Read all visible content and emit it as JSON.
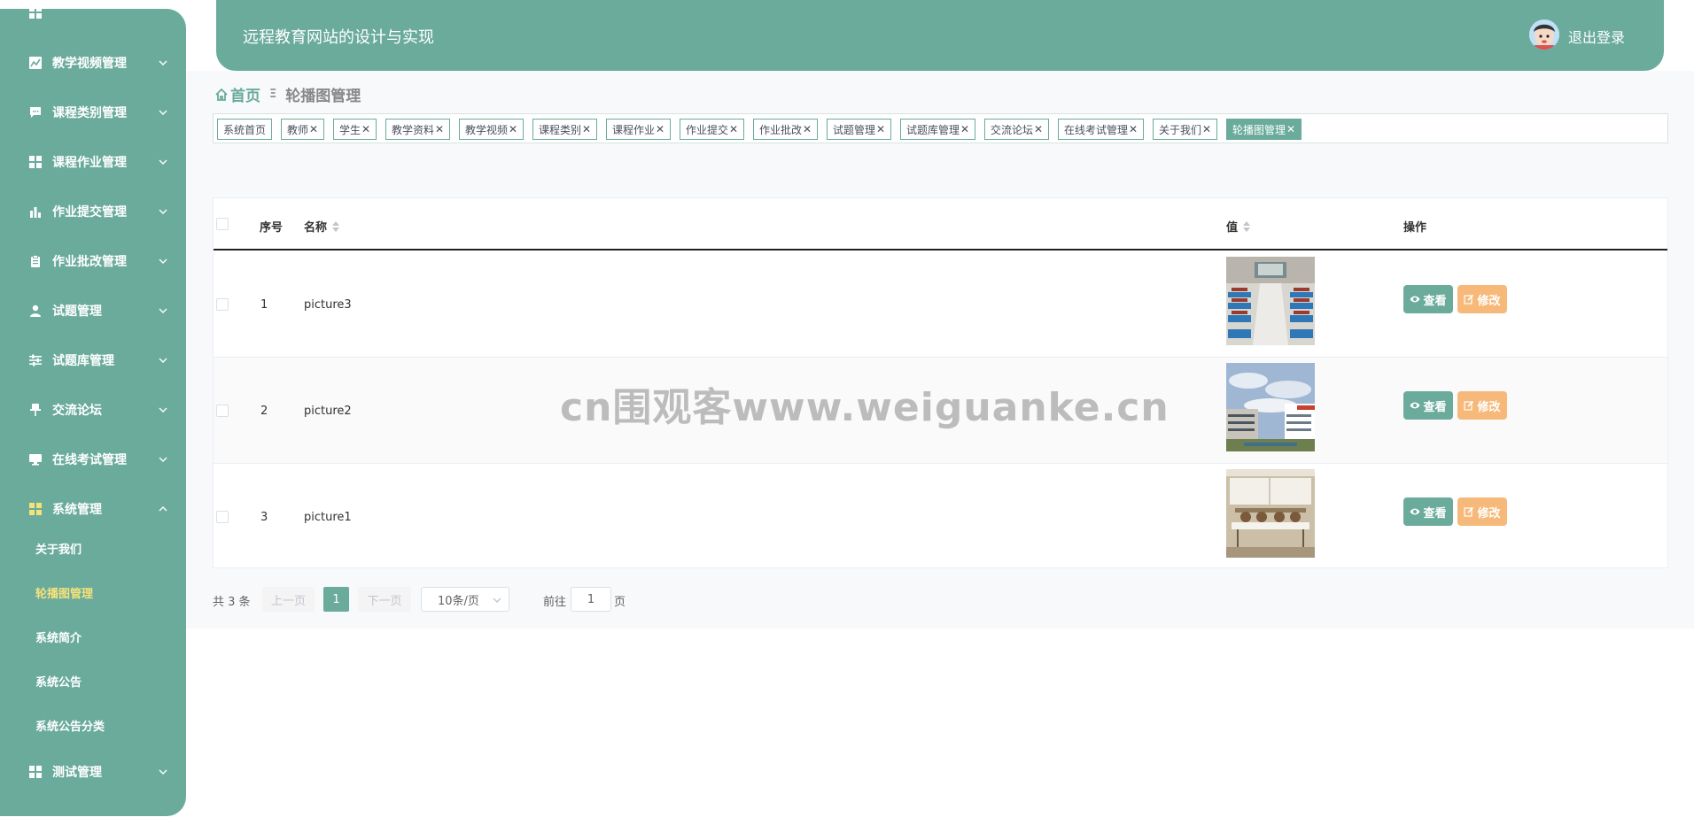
{
  "header": {
    "site_title": "远程教育网站的设计与实现",
    "logout_label": "退出登录"
  },
  "sidebar": {
    "items": [
      {
        "label": "教学视频管理",
        "icon": "line-chart-icon",
        "expanded": false
      },
      {
        "label": "课程类别管理",
        "icon": "chat-icon",
        "expanded": false
      },
      {
        "label": "课程作业管理",
        "icon": "grid-icon",
        "expanded": false
      },
      {
        "label": "作业提交管理",
        "icon": "bar-chart-icon",
        "expanded": false
      },
      {
        "label": "作业批改管理",
        "icon": "clipboard-icon",
        "expanded": false
      },
      {
        "label": "试题管理",
        "icon": "user-icon",
        "expanded": false
      },
      {
        "label": "试题库管理",
        "icon": "sliders-icon",
        "expanded": false
      },
      {
        "label": "交流论坛",
        "icon": "pin-icon",
        "expanded": false
      },
      {
        "label": "在线考试管理",
        "icon": "monitor-icon",
        "expanded": false
      },
      {
        "label": "系统管理",
        "icon": "grid-icon",
        "expanded": true
      },
      {
        "label": "测试管理",
        "icon": "grid-icon",
        "expanded": false
      }
    ],
    "sub_items": [
      {
        "label": "关于我们",
        "active": false
      },
      {
        "label": "轮播图管理",
        "active": true
      },
      {
        "label": "系统简介",
        "active": false
      },
      {
        "label": "系统公告",
        "active": false
      },
      {
        "label": "系统公告分类",
        "active": false
      }
    ]
  },
  "breadcrumb": {
    "home": "首页",
    "separator": "Ξ",
    "current": "轮播图管理"
  },
  "tags": [
    {
      "label": "系统首页",
      "closable": false,
      "active": false
    },
    {
      "label": "教师",
      "closable": true,
      "active": false
    },
    {
      "label": "学生",
      "closable": true,
      "active": false
    },
    {
      "label": "教学资料",
      "closable": true,
      "active": false
    },
    {
      "label": "教学视频",
      "closable": true,
      "active": false
    },
    {
      "label": "课程类别",
      "closable": true,
      "active": false
    },
    {
      "label": "课程作业",
      "closable": true,
      "active": false
    },
    {
      "label": "作业提交",
      "closable": true,
      "active": false
    },
    {
      "label": "作业批改",
      "closable": true,
      "active": false
    },
    {
      "label": "试题管理",
      "closable": true,
      "active": false
    },
    {
      "label": "试题库管理",
      "closable": true,
      "active": false
    },
    {
      "label": "交流论坛",
      "closable": true,
      "active": false
    },
    {
      "label": "在线考试管理",
      "closable": true,
      "active": false
    },
    {
      "label": "关于我们",
      "closable": true,
      "active": false
    },
    {
      "label": "轮播图管理",
      "closable": true,
      "active": true
    }
  ],
  "table": {
    "columns": {
      "index": "序号",
      "name": "名称",
      "value": "值",
      "actions": "操作"
    },
    "rows": [
      {
        "index": "1",
        "name": "picture3",
        "image": "classroom-photo"
      },
      {
        "index": "2",
        "name": "picture2",
        "image": "campus-building-photo"
      },
      {
        "index": "3",
        "name": "picture1",
        "image": "library-tables-photo"
      }
    ],
    "view_label": "查看",
    "edit_label": "修改"
  },
  "pagination": {
    "total_text": "共 3 条",
    "prev_label": "上一页",
    "current_page": "1",
    "next_label": "下一页",
    "page_size": "10条/页",
    "goto_label": "前往",
    "goto_value": "1",
    "page_suffix": "页"
  },
  "watermark": "cn围观客www.weiguanke.cn",
  "colors": {
    "primary": "#6aab9c",
    "edit": "#f6b97a",
    "active_sub": "#f6e27a"
  }
}
